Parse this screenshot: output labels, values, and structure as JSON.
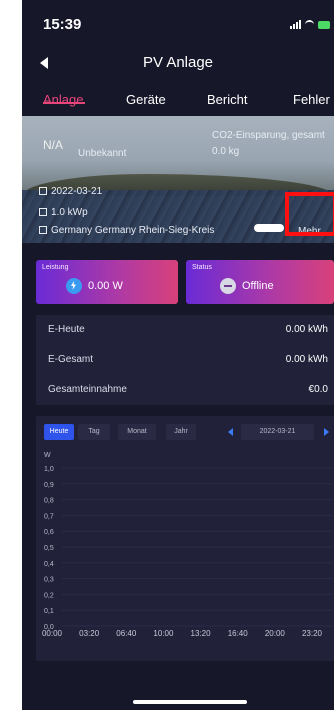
{
  "status_bar": {
    "time": "15:39"
  },
  "header": {
    "title": "PV Anlage"
  },
  "tabs": [
    {
      "label": "Anlage",
      "active": true
    },
    {
      "label": "Geräte",
      "active": false
    },
    {
      "label": "Bericht",
      "active": false
    },
    {
      "label": "Fehler",
      "active": false
    }
  ],
  "hero": {
    "plant_code": "N/A",
    "plant_status": "Unbekannt",
    "co2_label": "CO2-Einsparung, gesamt",
    "co2_value": "0.0 kg",
    "install_date": "2022-03-21",
    "capacity": "1.0 kWp",
    "location": "Germany Germany Rhein-Sieg-Kreis",
    "more_label": "Mehr"
  },
  "cards": {
    "power": {
      "label": "Leistung",
      "value": "0.00 W"
    },
    "status": {
      "label": "Status",
      "value": "Offline"
    }
  },
  "stats": [
    {
      "label": "E-Heute",
      "value": "0.00 kWh"
    },
    {
      "label": "E-Gesamt",
      "value": "0.00 kWh"
    },
    {
      "label": "Gesamteinnahme",
      "value": "€0.0"
    }
  ],
  "chart_controls": {
    "ranges": [
      {
        "label": "Heute",
        "active": true
      },
      {
        "label": "Tag",
        "active": false
      },
      {
        "label": "Monat",
        "active": false
      },
      {
        "label": "Jahr",
        "active": false
      }
    ],
    "date": "2022-03-21"
  },
  "chart_data": {
    "type": "line",
    "title": "",
    "xlabel": "",
    "ylabel": "W",
    "x": [
      "00:00",
      "03:20",
      "06:40",
      "10:00",
      "13:20",
      "16:40",
      "20:00",
      "23:20"
    ],
    "yticks": [
      "1,0",
      "0,9",
      "0,8",
      "0,7",
      "0,6",
      "0,5",
      "0,4",
      "0,3",
      "0,2",
      "0,1",
      "0,0"
    ],
    "ylim": [
      0,
      1.0
    ],
    "series": [],
    "grid": true
  },
  "colors": {
    "background": "#17172a",
    "accent": "#e8457a",
    "card_gradient_start": "#6a2bd6",
    "card_gradient_end": "#d8417a",
    "chip_active": "#2f54eb"
  }
}
